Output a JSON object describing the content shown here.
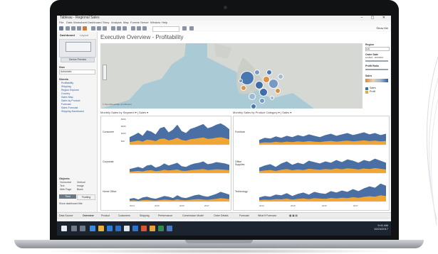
{
  "window": {
    "title": "Tableau - Regional Sales",
    "controls": "–  ▢  ✕"
  },
  "menu": [
    "File",
    "Data",
    "Worksheet",
    "Dashboard",
    "Story",
    "Analysis",
    "Map",
    "Format",
    "Server",
    "Window",
    "Help"
  ],
  "toolbar": {
    "show_me": "Show Me"
  },
  "left_pane": {
    "tabs": [
      "Dashboard",
      "Layout"
    ],
    "device_preview": "Device Preview",
    "size_label": "Size",
    "size_value": "Automatic",
    "sheets_label": "Sheets",
    "sheets": [
      "Profitability",
      "Shipping",
      "Region Explorer",
      "Country",
      "Sales Map",
      "Sales by Product",
      "Forecast",
      "Sales Forecast",
      "Shipping Dashboard"
    ],
    "objects_label": "Objects",
    "objects": [
      "Horizontal",
      "Vertical",
      "Text",
      "Image",
      "Web Page",
      "Blank"
    ],
    "tiled_button": "Tiled",
    "floating_button": "Floating",
    "show_title": "Show dashboard title"
  },
  "dashboard": {
    "title": "Executive Overview - Profitability"
  },
  "right_legends": {
    "region_label": "Region",
    "region_value": "(All)",
    "order_date_label": "Order Date",
    "date_value": "1/1/2014 - 12/31/2017",
    "profit_ratio_label": "Profit Ratio",
    "sales_label": "Sales",
    "legend_items": [
      "Sales",
      "Profit"
    ]
  },
  "map": {
    "attribution": "© OpenStreetMap contributors"
  },
  "charts": {
    "left_caption": "Monthly Sales by Segment ▾ | Sales ▾",
    "right_caption": "Monthly Sales by Product Category ▾ | Sales ▾",
    "left_rows": [
      "Consumer",
      "Corporate",
      "Home Office"
    ],
    "right_rows": [
      "Furniture",
      "Office Supplies",
      "Technology"
    ],
    "y_ticks": [
      "$60K",
      "$40K",
      "$20K",
      "$0K"
    ],
    "x_ticks": [
      "2014",
      "2015",
      "2016",
      "2017"
    ]
  },
  "chart_data": [
    {
      "type": "area",
      "title": "Monthly Sales by Segment",
      "series": [
        {
          "name": "Consumer",
          "values": [
            22,
            28,
            35,
            26,
            42,
            38,
            30,
            48,
            52,
            36,
            44,
            58,
            40,
            34,
            46,
            50,
            55,
            60,
            48,
            52,
            58,
            62,
            55,
            45
          ]
        },
        {
          "name": "Corporate",
          "values": [
            12,
            15,
            18,
            14,
            22,
            24,
            16,
            20,
            28,
            22,
            26,
            30,
            20,
            18,
            24,
            28,
            30,
            34,
            26,
            28,
            32,
            30,
            28,
            24
          ]
        },
        {
          "name": "Home Office",
          "values": [
            8,
            10,
            6,
            12,
            14,
            10,
            8,
            12,
            16,
            14,
            10,
            18,
            12,
            10,
            14,
            18,
            20,
            16,
            14,
            18,
            22,
            28,
            24,
            20
          ]
        }
      ]
    },
    {
      "type": "area",
      "title": "Monthly Sales by Product Category",
      "series": [
        {
          "name": "Furniture",
          "values": [
            14,
            20,
            18,
            24,
            20,
            26,
            22,
            28,
            24,
            30,
            26,
            22,
            28,
            32,
            26,
            30,
            34,
            28,
            32,
            36,
            30,
            34,
            28,
            32
          ]
        },
        {
          "name": "Office Supplies",
          "values": [
            16,
            22,
            26,
            18,
            28,
            34,
            24,
            30,
            26,
            36,
            32,
            28,
            34,
            30,
            38,
            32,
            40,
            36,
            30,
            38,
            34,
            42,
            36,
            30
          ]
        },
        {
          "name": "Technology",
          "values": [
            12,
            16,
            14,
            20,
            18,
            24,
            16,
            22,
            26,
            20,
            28,
            24,
            22,
            30,
            26,
            32,
            28,
            36,
            30,
            38,
            44,
            40,
            52,
            46
          ]
        }
      ]
    }
  ],
  "sheet_tabs": [
    "Data Source",
    "Overview",
    "Product",
    "Customers",
    "Shipping",
    "Performance",
    "Commission Model",
    "Order Details",
    "Forecast",
    "What If Forecast"
  ],
  "taskbar": {
    "time": "9:41 AM",
    "date": "10/24/2017"
  }
}
